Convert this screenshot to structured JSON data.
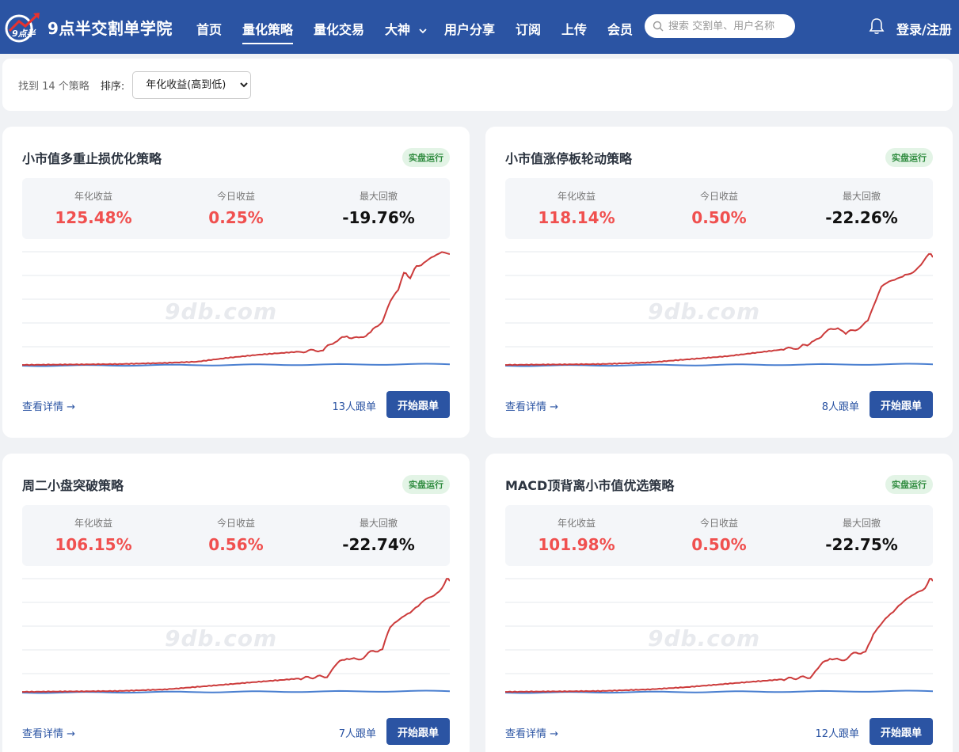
{
  "nav": {
    "brand": "9点半交割单学院",
    "logo_text": "9点半",
    "items": [
      {
        "label": "首页",
        "active": false
      },
      {
        "label": "量化策略",
        "active": true
      },
      {
        "label": "量化交易",
        "active": false
      },
      {
        "label": "大神",
        "active": false,
        "dropdown": true
      },
      {
        "label": "用户分享",
        "active": false
      },
      {
        "label": "订阅",
        "active": false
      },
      {
        "label": "上传",
        "active": false
      },
      {
        "label": "会员",
        "active": false
      }
    ],
    "search_placeholder": "搜索 交割单、用户名称",
    "login_label": "登录/注册",
    "colors": {
      "bar": "#2b54a3"
    }
  },
  "filter": {
    "found_text": "找到 14 个策略",
    "sort_label": "排序:",
    "sort_value": "年化收益(高到低)"
  },
  "labels": {
    "annual": "年化收益",
    "today": "今日收益",
    "drawdown": "最大回撤",
    "detail": "查看详情 →",
    "follow": "开始跟单",
    "watermark": "9db.com"
  },
  "cards": [
    {
      "title": "小市值多重止损优化策略",
      "badge": "实盘运行",
      "annual": "125.48%",
      "today": "0.25%",
      "drawdown": "-19.76%",
      "followers": "13人跟单",
      "profile": "a"
    },
    {
      "title": "小市值涨停板轮动策略",
      "badge": "实盘运行",
      "annual": "118.14%",
      "today": "0.50%",
      "drawdown": "-22.26%",
      "followers": "8人跟单",
      "profile": "b"
    },
    {
      "title": "周二小盘突破策略",
      "badge": "实盘运行",
      "annual": "106.15%",
      "today": "0.56%",
      "drawdown": "-22.74%",
      "followers": "7人跟单",
      "profile": "c"
    },
    {
      "title": "MACD顶背离小市值优选策略",
      "badge": "实盘运行",
      "annual": "101.98%",
      "today": "0.50%",
      "drawdown": "-22.75%",
      "followers": "12人跟单",
      "profile": "d"
    }
  ],
  "colors": {
    "strategy_line": "#cc3b3b",
    "benchmark_line": "#4a7fd0",
    "grid": "#e6e9ee",
    "positive": "#f0504f",
    "badge_bg": "#e3f4e6",
    "badge_text": "#2e8b3e"
  }
}
